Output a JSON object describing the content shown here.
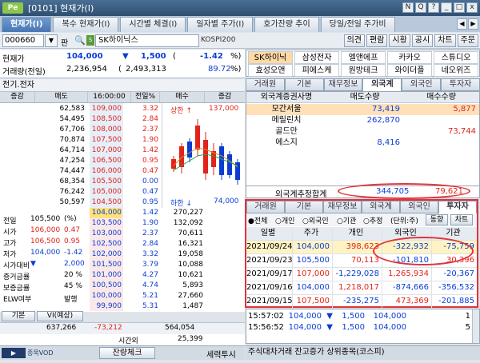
{
  "window": {
    "badge": "Pe",
    "title": "[0101] 현재가(I)"
  },
  "tabs": [
    "현재가(I)",
    "복수 현재가(I)",
    "시간별 체결(I)",
    "일자별 주가(I)",
    "호가잔량 추이",
    "당일/전일 주가비"
  ],
  "tabarrows": [
    "◀",
    "▶"
  ],
  "winbuttons": [
    "N",
    "Q",
    "?",
    "_",
    "□",
    "x"
  ],
  "symbol": {
    "code": "000660",
    "pan": "판",
    "name": "SK하이닉스",
    "market": "KOSPI200",
    "dropdown": "▼",
    "search": "🔍",
    "s": "S"
  },
  "toolbar": [
    "의견",
    "편람",
    "시황",
    "공시",
    "차트",
    "주문"
  ],
  "quote": {
    "l1": "현재가",
    "price": "104,000",
    "arrow": "▼",
    "change": "1,500",
    "paren_open": "(",
    "change_pct": "-1.42",
    "pct_sign": "%)",
    "l2": "거래량(전일)",
    "volume": "2,236,954",
    "paren2": "(",
    "prev_volume": "2,493,313",
    "turnover": "89.72",
    "pct2": "%)"
  },
  "subtitle": "전기.전자",
  "orderbook": {
    "headers": [
      "증감",
      "매도",
      "16:00:00",
      "전일%",
      "매수",
      "증감"
    ],
    "asks": [
      {
        "qty": "62,583",
        "price": "109,000",
        "pct": "3.32"
      },
      {
        "qty": "54,495",
        "price": "108,500",
        "pct": "2.84"
      },
      {
        "qty": "67,706",
        "price": "108,000",
        "pct": "2.37"
      },
      {
        "qty": "70,874",
        "price": "107,500",
        "pct": "1.90"
      },
      {
        "qty": "64,714",
        "price": "107,000",
        "pct": "1.42"
      },
      {
        "qty": "47,254",
        "price": "106,500",
        "pct": "0.95"
      },
      {
        "qty": "74,447",
        "price": "106,000",
        "pct": "0.47"
      },
      {
        "qty": "68,354",
        "price": "105,500",
        "pct": "0.00"
      },
      {
        "qty": "76,242",
        "price": "105,000",
        "pct": "0.47"
      },
      {
        "qty": "50,597",
        "price": "104,500",
        "pct": "0.95"
      }
    ],
    "bids": [
      {
        "price": "104,000",
        "pct": "1.42",
        "qty": "270,227"
      },
      {
        "price": "103,500",
        "pct": "1.90",
        "qty": "132,092"
      },
      {
        "price": "103,000",
        "pct": "2.37",
        "qty": "70,611"
      },
      {
        "price": "102,500",
        "pct": "2.84",
        "qty": "16,321"
      },
      {
        "price": "102,000",
        "pct": "3.32",
        "qty": "19,058"
      },
      {
        "price": "101,500",
        "pct": "3.79",
        "qty": "10,088"
      },
      {
        "price": "101,000",
        "pct": "4.27",
        "qty": "10,621"
      },
      {
        "price": "100,500",
        "pct": "4.74",
        "qty": "5,893"
      },
      {
        "price": "100,000",
        "pct": "5.21",
        "qty": "27,660"
      },
      {
        "price": "99,900",
        "pct": "5.31",
        "qty": "1,487"
      }
    ],
    "total_ask": "637,266",
    "diff": "-73,212",
    "total_bid": "564,054",
    "after_label": "시간외",
    "after_value": "25,399"
  },
  "upper": {
    "label": "상한",
    "arrow": "↑",
    "value": "137,000"
  },
  "lower": {
    "label": "하한",
    "arrow": "↓",
    "value": "74,000"
  },
  "info": {
    "rows": [
      {
        "k": "전일",
        "v": "105,500",
        "u": "(%)"
      },
      {
        "k": "시가",
        "v": "106,000",
        "u": "0.47"
      },
      {
        "k": "고가",
        "v": "106,500",
        "u": "0.95"
      },
      {
        "k": "저가",
        "v": "104,000",
        "u": "-1.42"
      },
      {
        "k": "시가대비",
        "v": "▼",
        "u": "2,000"
      },
      {
        "k": "증거금률",
        "v": "",
        "u": "20 %"
      },
      {
        "k": "보증금률",
        "v": "",
        "u": "45 %"
      },
      {
        "k": "ELW여부",
        "v": "",
        "u": "발행"
      }
    ],
    "btn1": "기본",
    "btn2": "VI(예상)"
  },
  "bottom_left": {
    "btn": "잔량체크",
    "right": "세력투시",
    "logo": "종목VOD"
  },
  "peers": [
    "SK하이닉",
    "삼성전자",
    "엘앤에프",
    "카카오",
    "스튜디오",
    "효성오앤",
    "피에스케",
    "원방테크",
    "와이더플",
    "네오위즈"
  ],
  "rtabs": [
    "거래원",
    "기본",
    "재무정보",
    "외국계",
    "외국인",
    "투자자"
  ],
  "foreign": {
    "headers": [
      "외국계증권사명",
      "매도수량",
      "매수수량"
    ],
    "rows": [
      {
        "name": "모간서울",
        "sell": "73,419",
        "buy": "5,877"
      },
      {
        "name": "메릴린치",
        "sell": "262,870",
        "buy": ""
      },
      {
        "name": "골드만",
        "sell": "",
        "buy": "73,744"
      },
      {
        "name": "에스지",
        "sell": "8,416",
        "buy": ""
      }
    ],
    "total_label": "외국계추정합계",
    "total_sell": "344,705",
    "total_buy": "79,621"
  },
  "investor": {
    "tabs": [
      "거래원",
      "기본",
      "재무정보",
      "외국계",
      "외국인",
      "투자자"
    ],
    "radios": [
      "●전체",
      "○개인",
      "○외국인",
      "○기관",
      "○추정",
      "(단위:주)"
    ],
    "btns": [
      "동향",
      "차트"
    ],
    "headers": [
      "일별",
      "주가",
      "개인",
      "외국인",
      "기관"
    ],
    "rows": [
      {
        "date": "2021/09/24",
        "price": "104,000",
        "ind": "398,623",
        "frn": "-322,932",
        "inst": "-75,759"
      },
      {
        "date": "2021/09/23",
        "price": "105,500",
        "ind": "70,113",
        "frn": "-101,810",
        "inst": "30,396"
      },
      {
        "date": "2021/09/17",
        "price": "107,000",
        "ind": "-1,229,028",
        "frn": "1,265,934",
        "inst": "-20,367"
      },
      {
        "date": "2021/09/16",
        "price": "104,000",
        "ind": "1,218,017",
        "frn": "-874,666",
        "inst": "-356,532"
      },
      {
        "date": "2021/09/15",
        "price": "107,500",
        "ind": "-235,275",
        "frn": "473,369",
        "inst": "-201,885"
      }
    ]
  },
  "ticks": [
    {
      "time": "15:57:02",
      "price": "104,000",
      "arrow": "▼",
      "chg": "1,500",
      "vol": "104,000",
      "n": "1"
    },
    {
      "time": "15:56:52",
      "price": "104,000",
      "arrow": "▼",
      "chg": "1,500",
      "vol": "104,000",
      "n": "5"
    }
  ],
  "status": "주식대차거래 잔고증가 상위종목(코스피)",
  "colors": {
    "up": "#e2231a",
    "down": "#0b3cd6",
    "highlight": "#e0333a"
  }
}
